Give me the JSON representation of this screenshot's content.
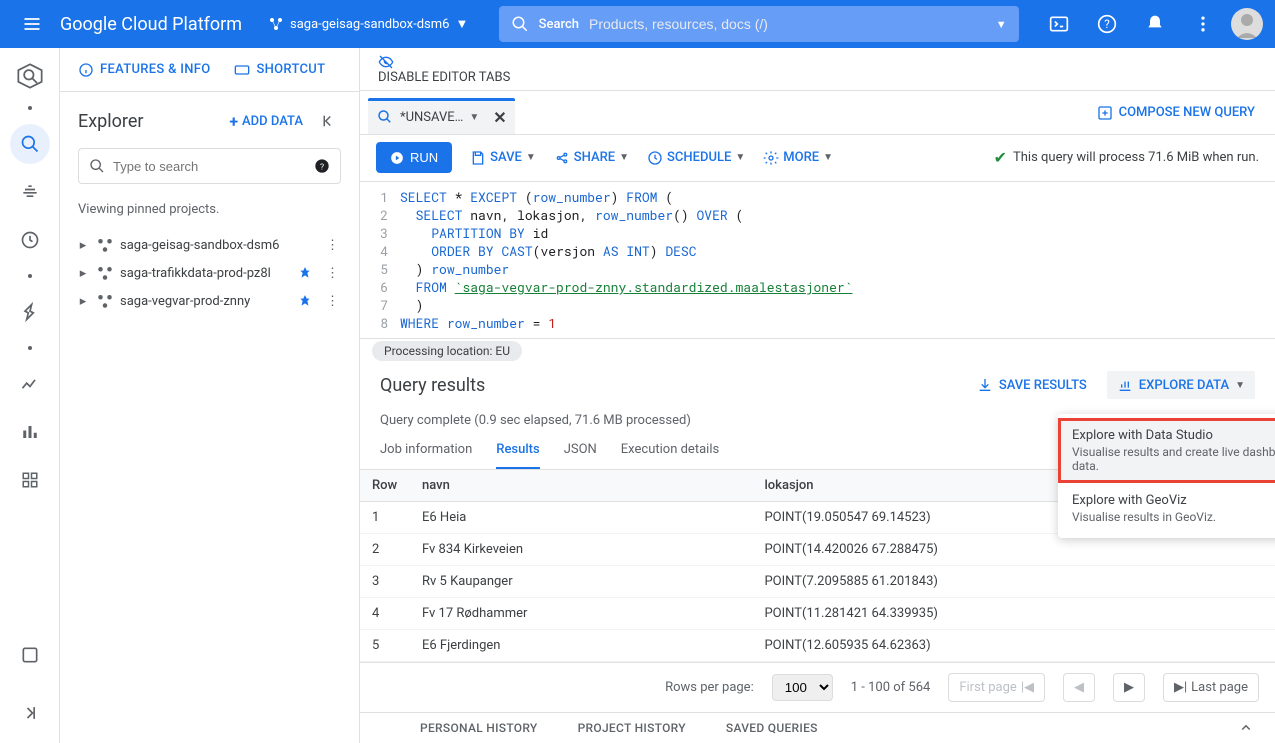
{
  "header": {
    "logo": "Google Cloud Platform",
    "project": "saga-geisag-sandbox-dsm6",
    "search_label": "Search",
    "search_placeholder": "Products, resources, docs (/)"
  },
  "top_actions": {
    "features": "FEATURES & INFO",
    "shortcut": "SHORTCUT",
    "disable_tabs": "DISABLE EDITOR TABS"
  },
  "explorer": {
    "title": "Explorer",
    "add_data": "ADD DATA",
    "search_placeholder": "Type to search",
    "pin_text": "Viewing pinned projects.",
    "projects": [
      {
        "name": "saga-geisag-sandbox-dsm6",
        "pinned": false
      },
      {
        "name": "saga-trafikkdata-prod-pz8l",
        "pinned": true
      },
      {
        "name": "saga-vegvar-prod-znny",
        "pinned": true
      }
    ]
  },
  "tabs": {
    "active": "*UNSAVE…",
    "compose": "COMPOSE NEW QUERY"
  },
  "toolbar": {
    "run": "RUN",
    "save": "SAVE",
    "share": "SHARE",
    "schedule": "SCHEDULE",
    "more": "MORE",
    "process_msg": "This query will process 71.6 MiB when run."
  },
  "sql": {
    "lines": [
      {
        "n": 1,
        "tokens": [
          [
            "kw",
            "SELECT"
          ],
          [
            "id",
            " * "
          ],
          [
            "kw",
            "EXCEPT"
          ],
          [
            "id",
            " ("
          ],
          [
            "fn",
            "row_number"
          ],
          [
            "id",
            ") "
          ],
          [
            "kw",
            "FROM"
          ],
          [
            "id",
            " ("
          ]
        ]
      },
      {
        "n": 2,
        "tokens": [
          [
            "id",
            "  "
          ],
          [
            "kw",
            "SELECT"
          ],
          [
            "id",
            " navn, lokasjon, "
          ],
          [
            "fn",
            "row_number"
          ],
          [
            "id",
            "() "
          ],
          [
            "kw",
            "OVER"
          ],
          [
            "id",
            " ("
          ]
        ]
      },
      {
        "n": 3,
        "tokens": [
          [
            "id",
            "    "
          ],
          [
            "kw",
            "PARTITION BY"
          ],
          [
            "id",
            " id"
          ]
        ]
      },
      {
        "n": 4,
        "tokens": [
          [
            "id",
            "    "
          ],
          [
            "kw",
            "ORDER BY"
          ],
          [
            "id",
            " "
          ],
          [
            "kw",
            "CAST"
          ],
          [
            "id",
            "(versjon "
          ],
          [
            "kw",
            "AS"
          ],
          [
            "id",
            " "
          ],
          [
            "kw",
            "INT"
          ],
          [
            "id",
            ") "
          ],
          [
            "kw",
            "DESC"
          ]
        ]
      },
      {
        "n": 5,
        "tokens": [
          [
            "id",
            "  ) "
          ],
          [
            "fn",
            "row_number"
          ]
        ]
      },
      {
        "n": 6,
        "tokens": [
          [
            "id",
            "  "
          ],
          [
            "kw",
            "FROM"
          ],
          [
            "id",
            " "
          ],
          [
            "str",
            "`saga-vegvar-prod-znny.standardized.maalestasjoner`"
          ]
        ]
      },
      {
        "n": 7,
        "tokens": [
          [
            "id",
            "  )"
          ]
        ]
      },
      {
        "n": 8,
        "tokens": [
          [
            "kw",
            "WHERE"
          ],
          [
            "id",
            " "
          ],
          [
            "fn",
            "row_number"
          ],
          [
            "id",
            " = "
          ],
          [
            "num",
            "1"
          ]
        ]
      }
    ],
    "proc_loc": "Processing location: EU"
  },
  "results": {
    "title": "Query results",
    "save": "SAVE RESULTS",
    "explore": "EXPLORE DATA",
    "complete": "Query complete (0.9 sec elapsed, 71.6 MB processed)",
    "tabs": [
      "Job information",
      "Results",
      "JSON",
      "Execution details"
    ],
    "active_tab": "Results",
    "columns": [
      "Row",
      "navn",
      "lokasjon"
    ],
    "rows": [
      {
        "row": "1",
        "navn": "E6 Heia",
        "lokasjon": "POINT(19.050547 69.14523)"
      },
      {
        "row": "2",
        "navn": "Fv 834 Kirkeveien",
        "lokasjon": "POINT(14.420026 67.288475)"
      },
      {
        "row": "3",
        "navn": "Rv 5 Kaupanger",
        "lokasjon": "POINT(7.2095885 61.201843)"
      },
      {
        "row": "4",
        "navn": "Fv 17 Rødhammer",
        "lokasjon": "POINT(11.281421 64.339935)"
      },
      {
        "row": "5",
        "navn": "E6 Fjerdingen",
        "lokasjon": "POINT(12.605935 64.62363)"
      }
    ],
    "footer": {
      "rows_per_page_label": "Rows per page:",
      "rows_per_page": "100",
      "range": "1 - 100 of 564",
      "first": "First page",
      "last": "Last page"
    }
  },
  "dropdown": {
    "items": [
      {
        "title": "Explore with Data Studio",
        "desc": "Visualise results and create live dashboards from your data.",
        "highlighted": true
      },
      {
        "title": "Explore with GeoViz",
        "desc": "Visualise results in GeoViz.",
        "highlighted": false
      }
    ]
  },
  "history": {
    "personal": "PERSONAL HISTORY",
    "project": "PROJECT HISTORY",
    "saved": "SAVED QUERIES"
  }
}
